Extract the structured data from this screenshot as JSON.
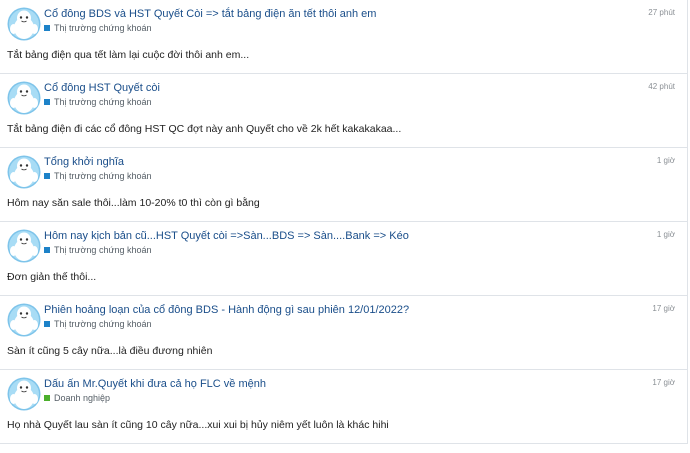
{
  "colors": {
    "link": "#1a4e8a",
    "category_stock": "#1d82c8",
    "category_business": "#4caf2c",
    "divider": "#dfe3e8"
  },
  "posts": [
    {
      "title": "Cổ đông BDS và HST Quyết Còi => tắt bảng điện ăn tết thôi anh em",
      "category": "Thị trường chứng khoán",
      "category_color": "#1d82c8",
      "time": "27 phút",
      "excerpt": "Tắt bảng điện qua tết làm lại cuộc đời thôi anh em..."
    },
    {
      "title": "Cổ đông HST Quyết còi",
      "category": "Thị trường chứng khoán",
      "category_color": "#1d82c8",
      "time": "42 phút",
      "excerpt": "Tắt bảng điện đi các cổ đông HST QC đợt này anh Quyết cho về 2k hết kakakakaa..."
    },
    {
      "title": "Tổng khởi nghĩa",
      "category": "Thị trường chứng khoán",
      "category_color": "#1d82c8",
      "time": "1 giờ",
      "excerpt": "Hôm nay săn sale thôi...làm 10-20% t0 thì còn gì bằng"
    },
    {
      "title": "Hôm nay kịch bản cũ...HST Quyết còi =>Sàn...BDS => Sàn....Bank => Kéo",
      "category": "Thị trường chứng khoán",
      "category_color": "#1d82c8",
      "time": "1 giờ",
      "excerpt": "Đơn giản thế thôi..."
    },
    {
      "title": "Phiên hoảng loạn của cổ đông BDS - Hành động gì sau phiên 12/01/2022?",
      "category": "Thị trường chứng khoán",
      "category_color": "#1d82c8",
      "time": "17 giờ",
      "excerpt": "Sàn ít cũng 5 cây nữa...là điều đương nhiên"
    },
    {
      "title": "Dấu ấn Mr.Quyết khi đưa cả họ FLC về mệnh",
      "category": "Doanh nghiệp",
      "category_color": "#4caf2c",
      "time": "17 giờ",
      "excerpt": "Họ nhà Quyết lau sàn ít cũng 10 cây nữa...xui xui bị hủy niêm yết luôn là khác hihi"
    }
  ]
}
